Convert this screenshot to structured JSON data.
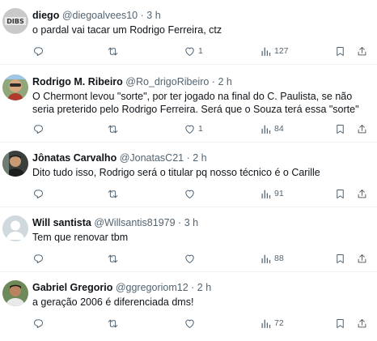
{
  "replies": [
    {
      "name": "diego",
      "handle": "@diegoalvees10",
      "time": "3 h",
      "text": "o pardal vai tacar um Rodrigo Ferreira, ctz",
      "replies": "",
      "retweets": "",
      "likes": "1",
      "views": "127"
    },
    {
      "name": "Rodrigo M. Ribeiro",
      "handle": "@Ro_drigoRibeiro",
      "time": "2 h",
      "text": "O Chermont levou \"sorte\", por ter jogado na final do C. Paulista, se não seria preterido pelo Rodrigo Ferreira. Será que o Souza terá essa \"sorte\"",
      "replies": "",
      "retweets": "",
      "likes": "1",
      "views": "84"
    },
    {
      "name": "Jônatas Carvalho",
      "handle": "@JonatasC21",
      "time": "2 h",
      "text": "Dito tudo isso, Rodrigo será o titular pq nosso técnico é o Carille",
      "replies": "",
      "retweets": "",
      "likes": "",
      "views": "91"
    },
    {
      "name": "Will santista",
      "handle": "@Willsantis81979",
      "time": "3 h",
      "text": "Tem que renovar tbm",
      "replies": "",
      "retweets": "",
      "likes": "",
      "views": "88"
    },
    {
      "name": "Gabriel Gregorio",
      "handle": "@ggregoriom12",
      "time": "2 h",
      "text": "a geração 2006 é diferenciada dms!",
      "replies": "",
      "retweets": "",
      "likes": "",
      "views": "72"
    }
  ],
  "separator": "·",
  "icons": {
    "reply": "reply-icon",
    "retweet": "retweet-icon",
    "like": "heart-icon",
    "views": "views-icon",
    "bookmark": "bookmark-icon",
    "share": "share-icon"
  },
  "colors": {
    "text": "#0f1419",
    "secondary": "#536471",
    "divider": "#eff3f4"
  }
}
